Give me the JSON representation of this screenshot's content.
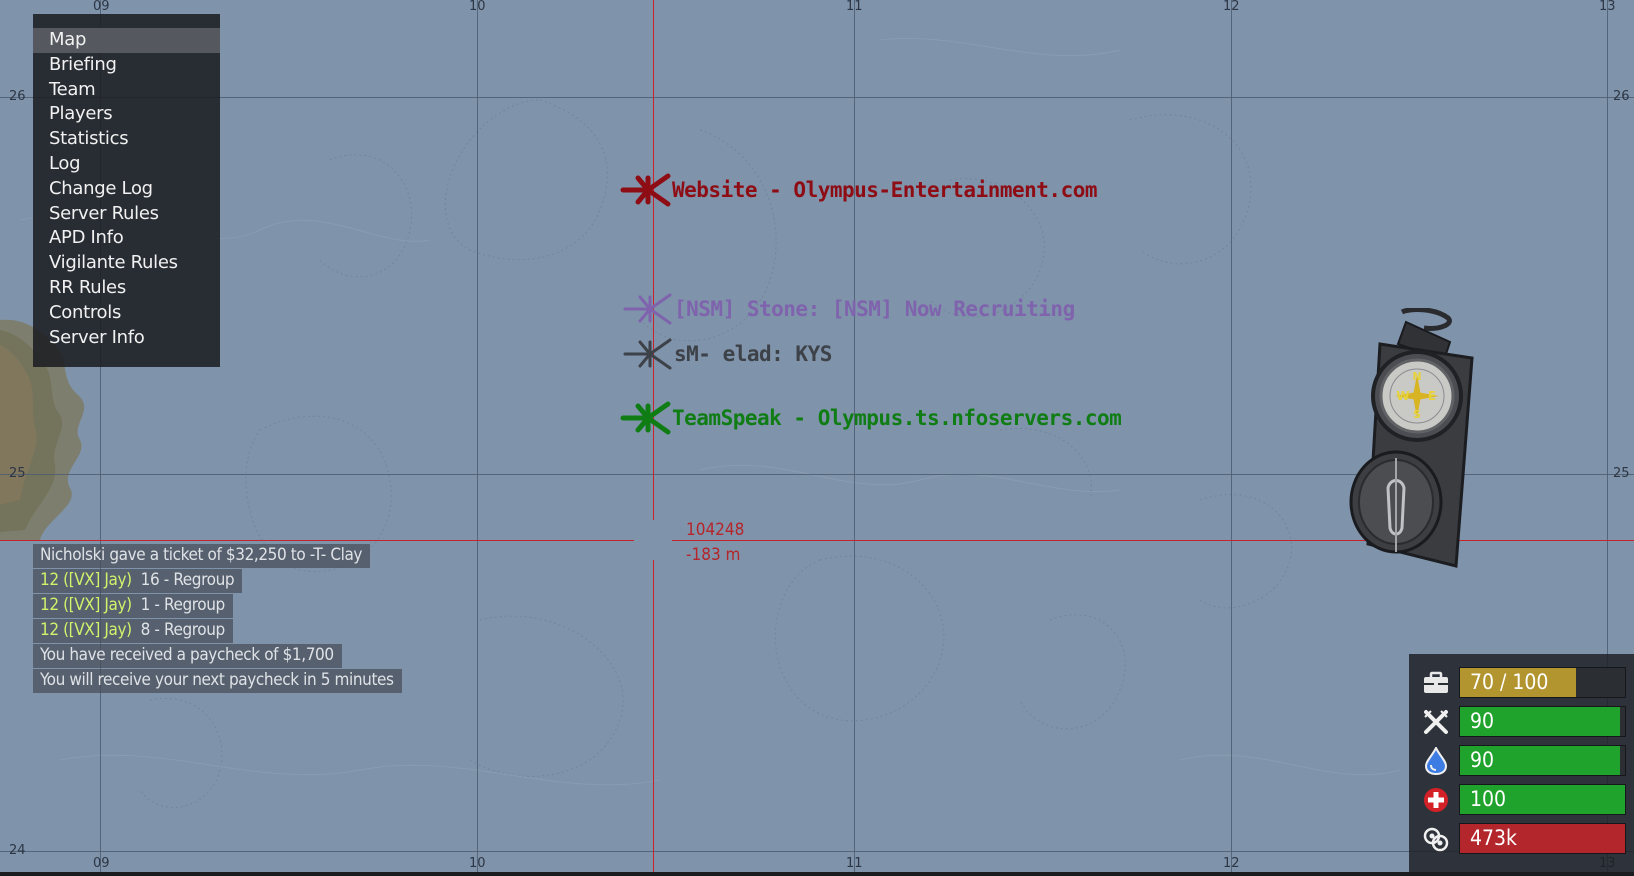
{
  "menu": {
    "items": [
      {
        "label": "Map",
        "active": true
      },
      {
        "label": "Briefing"
      },
      {
        "label": "Team"
      },
      {
        "label": "Players"
      },
      {
        "label": "Statistics"
      },
      {
        "label": "Log"
      },
      {
        "label": "Change Log"
      },
      {
        "label": "Server Rules"
      },
      {
        "label": "APD Info"
      },
      {
        "label": "Vigilante Rules"
      },
      {
        "label": "RR Rules"
      },
      {
        "label": "Controls"
      },
      {
        "label": "Server Info"
      }
    ]
  },
  "grid": {
    "x_labels": [
      "09",
      "10",
      "11",
      "12",
      "13"
    ],
    "y_labels": [
      "26",
      "25",
      "24"
    ]
  },
  "markers": [
    {
      "text": "Website - Olympus-Entertainment.com",
      "color": "#8e0d14"
    },
    {
      "text": "[NSM] Stone: [NSM] Now Recruiting",
      "color": "#7f63ad"
    },
    {
      "text": "sM- elad: KYS",
      "color": "#3d4148"
    },
    {
      "text": "TeamSpeak - Olympus.ts.nfoservers.com",
      "color": "#0f7d14"
    }
  ],
  "cursor": {
    "grid_ref": "104248",
    "elevation": "-183 m"
  },
  "chat": [
    {
      "name": "",
      "text": "Nicholski gave a ticket of $32,250 to -T- Clay"
    },
    {
      "name": "12 ([VX] Jay)",
      "text": "16 - Regroup"
    },
    {
      "name": "12 ([VX] Jay)",
      "text": "1 - Regroup"
    },
    {
      "name": "12 ([VX] Jay)",
      "text": "8 - Regroup"
    },
    {
      "name": "",
      "text": "You have received a paycheck of $1,700"
    },
    {
      "name": "",
      "text": "You will receive your next paycheck in 5 minutes"
    }
  ],
  "compass": {
    "letters": [
      "N",
      "W",
      "E",
      "S"
    ]
  },
  "hud": [
    {
      "icon": "inventory-icon",
      "value": "70 / 100",
      "fill": 0.7,
      "color": "#b39530"
    },
    {
      "icon": "food-icon",
      "value": "90",
      "fill": 0.97,
      "color": "#20a32c"
    },
    {
      "icon": "water-icon",
      "value": "90",
      "fill": 0.97,
      "color": "#20a32c"
    },
    {
      "icon": "health-icon",
      "value": "100",
      "fill": 1.0,
      "color": "#20a32c"
    },
    {
      "icon": "money-icon",
      "value": "473k",
      "fill": 1.0,
      "color": "#b3262b"
    }
  ]
}
